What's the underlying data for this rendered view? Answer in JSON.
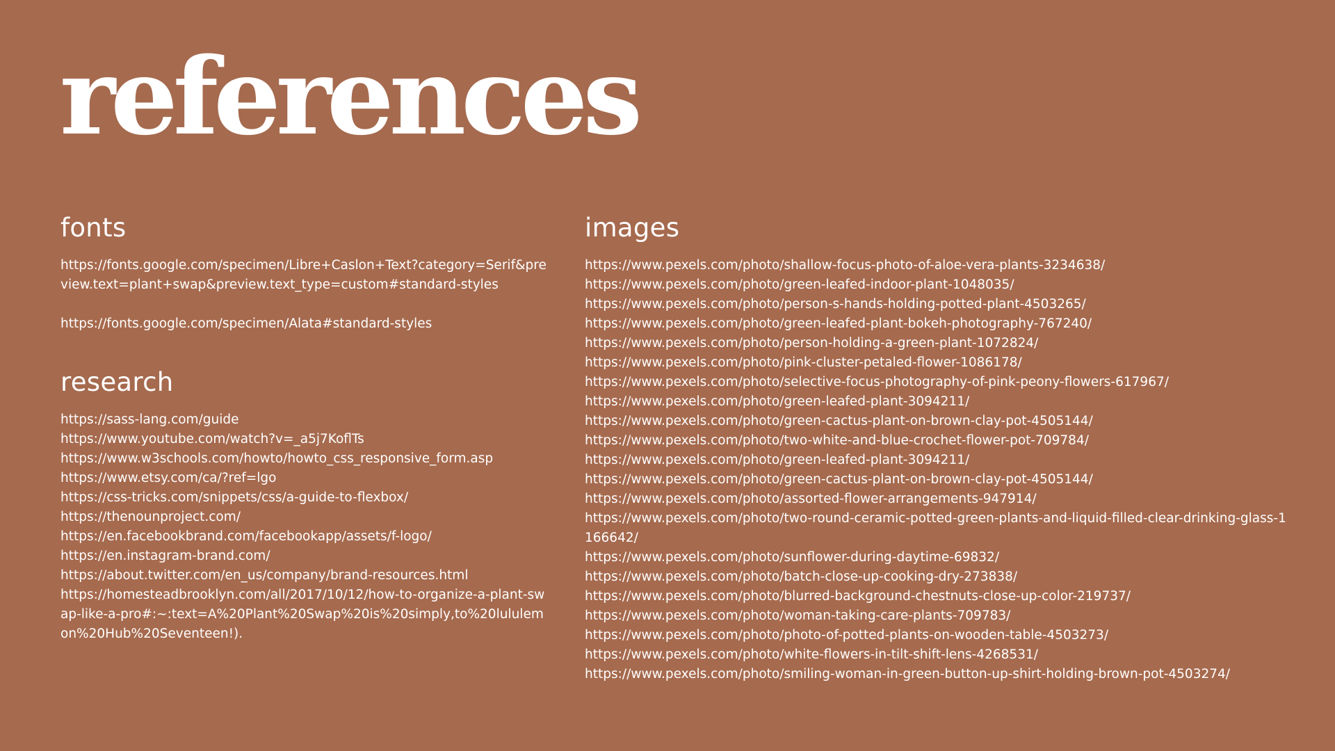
{
  "page": {
    "title": "references",
    "background": "#a66a4e",
    "text_color": "#ffffff"
  },
  "fonts": {
    "heading": "fonts",
    "items": [
      "https://fonts.google.com/specimen/Libre+Caslon+Text?category=Serif&preview.text=plant+swap&preview.text_type=custom#standard-styles",
      "https://fonts.google.com/specimen/Alata#standard-styles"
    ]
  },
  "research": {
    "heading": "research",
    "items": [
      "https://sass-lang.com/guide",
      "https://www.youtube.com/watch?v=_a5j7KoflTs",
      "https://www.w3schools.com/howto/howto_css_responsive_form.asp",
      "https://www.etsy.com/ca/?ref=lgo",
      "https://css-tricks.com/snippets/css/a-guide-to-flexbox/",
      "https://thenounproject.com/",
      "https://en.facebookbrand.com/facebookapp/assets/f-logo/",
      "https://en.instagram-brand.com/",
      "https://about.twitter.com/en_us/company/brand-resources.html",
      "https://homesteadbrooklyn.com/all/2017/10/12/how-to-organize-a-plant-swap-like-a-pro#:~:text=A%20Plant%20Swap%20is%20simply,to%20lululemon%20Hub%20Seventeen!)."
    ]
  },
  "images": {
    "heading": "images",
    "items": [
      "https://www.pexels.com/photo/shallow-focus-photo-of-aloe-vera-plants-3234638/",
      "https://www.pexels.com/photo/green-leafed-indoor-plant-1048035/",
      "https://www.pexels.com/photo/person-s-hands-holding-potted-plant-4503265/",
      "https://www.pexels.com/photo/green-leafed-plant-bokeh-photography-767240/",
      "https://www.pexels.com/photo/person-holding-a-green-plant-1072824/",
      "https://www.pexels.com/photo/pink-cluster-petaled-flower-1086178/",
      "https://www.pexels.com/photo/selective-focus-photography-of-pink-peony-flowers-617967/",
      "https://www.pexels.com/photo/green-leafed-plant-3094211/",
      "https://www.pexels.com/photo/green-cactus-plant-on-brown-clay-pot-4505144/",
      "https://www.pexels.com/photo/two-white-and-blue-crochet-flower-pot-709784/",
      "https://www.pexels.com/photo/green-leafed-plant-3094211/",
      "https://www.pexels.com/photo/green-cactus-plant-on-brown-clay-pot-4505144/",
      "https://www.pexels.com/photo/assorted-flower-arrangements-947914/",
      "https://www.pexels.com/photo/two-round-ceramic-potted-green-plants-and-liquid-filled-clear-drinking-glass-1166642/",
      "https://www.pexels.com/photo/sunflower-during-daytime-69832/",
      "https://www.pexels.com/photo/batch-close-up-cooking-dry-273838/",
      "https://www.pexels.com/photo/blurred-background-chestnuts-close-up-color-219737/",
      "https://www.pexels.com/photo/woman-taking-care-plants-709783/",
      "https://www.pexels.com/photo/photo-of-potted-plants-on-wooden-table-4503273/",
      "https://www.pexels.com/photo/white-flowers-in-tilt-shift-lens-4268531/",
      "https://www.pexels.com/photo/smiling-woman-in-green-button-up-shirt-holding-brown-pot-4503274/"
    ]
  }
}
